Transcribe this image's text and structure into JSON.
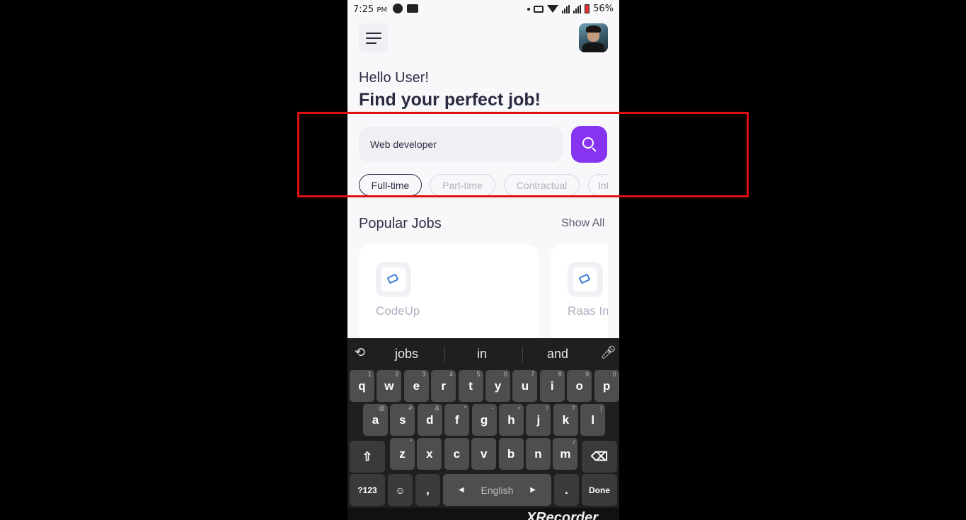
{
  "status_bar": {
    "time": "7:25",
    "ampm": "PM",
    "battery": "56%",
    "net1": "4G",
    "net2": "4G"
  },
  "header": {
    "menu_icon": "hamburger-menu-icon",
    "avatar": "user-avatar"
  },
  "greeting": "Hello User!",
  "headline": "Find your perfect job!",
  "search": {
    "value": "Web developer",
    "button_icon": "search-icon"
  },
  "job_types": [
    {
      "label": "Full-time",
      "active": true
    },
    {
      "label": "Part-time",
      "active": false
    },
    {
      "label": "Contractual",
      "active": false
    },
    {
      "label": "Int",
      "active": false
    }
  ],
  "popular": {
    "title": "Popular Jobs",
    "show_all": "Show All",
    "jobs": [
      {
        "company": "CodeUp"
      },
      {
        "company": "Raas Int"
      }
    ]
  },
  "keyboard": {
    "suggestions": [
      "jobs",
      "in",
      "and"
    ],
    "row1": [
      {
        "k": "q",
        "h": "1"
      },
      {
        "k": "w",
        "h": "2"
      },
      {
        "k": "e",
        "h": "3"
      },
      {
        "k": "r",
        "h": "4"
      },
      {
        "k": "t",
        "h": "5"
      },
      {
        "k": "y",
        "h": "6"
      },
      {
        "k": "u",
        "h": "7"
      },
      {
        "k": "i",
        "h": "8"
      },
      {
        "k": "o",
        "h": "9"
      },
      {
        "k": "p",
        "h": "0"
      }
    ],
    "row2": [
      {
        "k": "a",
        "h": "@"
      },
      {
        "k": "s",
        "h": "#"
      },
      {
        "k": "d",
        "h": "&"
      },
      {
        "k": "f",
        "h": "*"
      },
      {
        "k": "g",
        "h": "-"
      },
      {
        "k": "h",
        "h": "+"
      },
      {
        "k": "j",
        "h": "!"
      },
      {
        "k": "k",
        "h": "?"
      },
      {
        "k": "l",
        "h": "("
      }
    ],
    "row3": [
      {
        "k": "z",
        "h": "\""
      },
      {
        "k": "x",
        "h": ""
      },
      {
        "k": "c",
        "h": ""
      },
      {
        "k": "v",
        "h": ""
      },
      {
        "k": "b",
        "h": ""
      },
      {
        "k": "n",
        "h": ""
      },
      {
        "k": "m",
        "h": "/"
      }
    ],
    "symbols_key": "?123",
    "comma": ",",
    "space_label": "English",
    "period": ".",
    "done": "Done"
  },
  "watermark": "XRecorder"
}
